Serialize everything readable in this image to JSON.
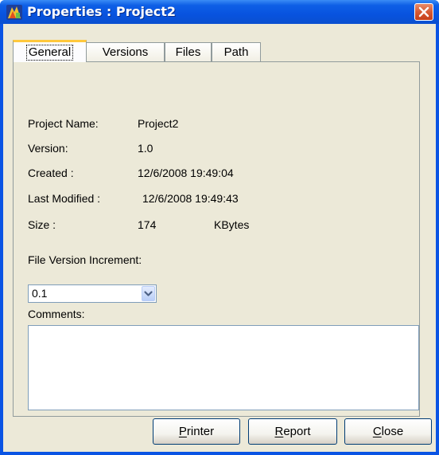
{
  "window": {
    "title": "Properties : Project2",
    "close_glyph": "×",
    "colors": {
      "titlebar": "#0a54e4",
      "client": "#ece9d8",
      "close_button": "#d65a34",
      "active_tab_accent": "#ffc83c"
    }
  },
  "tabs": [
    {
      "label": "General",
      "active": true
    },
    {
      "label": "Versions",
      "active": false
    },
    {
      "label": "Files",
      "active": false
    },
    {
      "label": "Path",
      "active": false
    }
  ],
  "properties": {
    "project_name_label": "Project Name:",
    "project_name_value": "Project2",
    "version_label": "Version:",
    "version_value": "1.0",
    "created_label": "Created :",
    "created_value": "12/6/2008 19:49:04",
    "modified_label": "Last Modified :",
    "modified_value": "12/6/2008 19:49:43",
    "size_label": "Size :",
    "size_value": "174",
    "size_unit": "KBytes"
  },
  "increment": {
    "label": "File Version Increment:",
    "selected": "0.1"
  },
  "comments": {
    "label": "Comments:",
    "value": ""
  },
  "buttons": {
    "printer": "Printer",
    "report": "Report",
    "close": "Close"
  }
}
